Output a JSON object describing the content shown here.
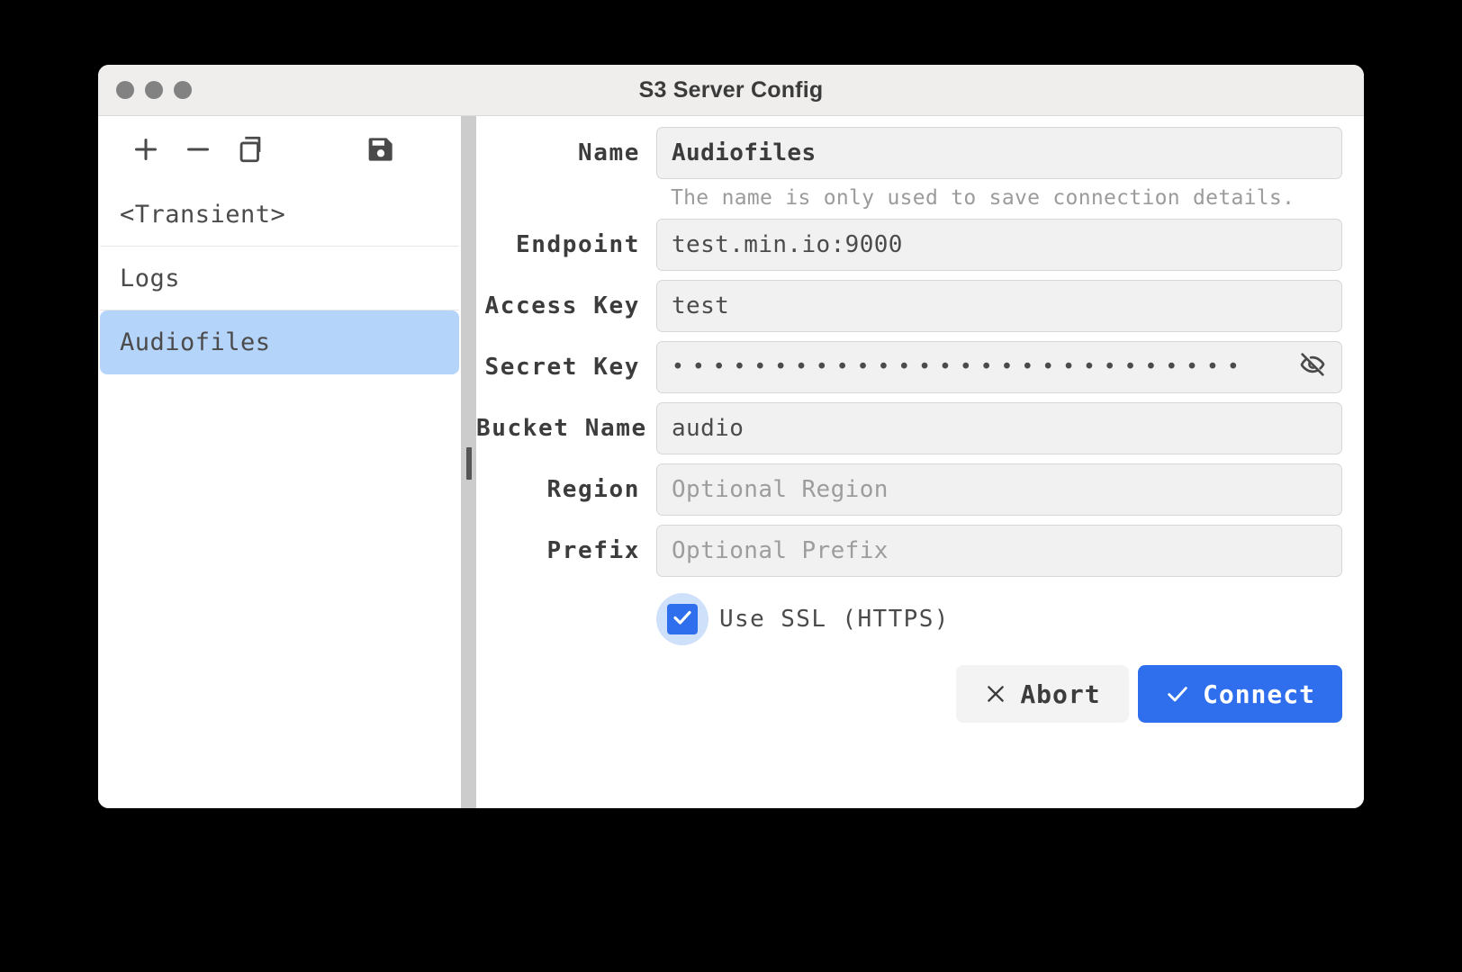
{
  "window": {
    "title": "S3 Server Config",
    "traffic_lights": [
      "close",
      "minimize",
      "maximize"
    ]
  },
  "sidebar": {
    "toolbar": [
      {
        "name": "add",
        "icon": "plus-icon"
      },
      {
        "name": "remove",
        "icon": "minus-icon"
      },
      {
        "name": "duplicate",
        "icon": "copy-icon"
      },
      {
        "name": "save",
        "icon": "floppy-save-icon"
      }
    ],
    "items": [
      {
        "label": "<Transient>",
        "selected": false
      },
      {
        "label": "Logs",
        "selected": false
      },
      {
        "label": "Audiofiles",
        "selected": true
      }
    ]
  },
  "form": {
    "fields": [
      {
        "label": "Name",
        "value": "Audiofiles",
        "placeholder": ""
      },
      {
        "label": "Endpoint",
        "value": "test.min.io:9000",
        "placeholder": ""
      },
      {
        "label": "Access Key",
        "value": "test",
        "placeholder": ""
      },
      {
        "label": "Secret Key",
        "value": "••••••••••••••••••••••••••••",
        "placeholder": ""
      },
      {
        "label": "Bucket Name",
        "value": "audio",
        "placeholder": ""
      },
      {
        "label": "Region",
        "value": "",
        "placeholder": "Optional Region"
      },
      {
        "label": "Prefix",
        "value": "",
        "placeholder": "Optional Prefix"
      }
    ],
    "name_help": "The name is only used to save connection details.",
    "secret_mask": "••••••••••••••••••••••••••••",
    "reveal_icon": "eye-off-icon",
    "ssl": {
      "label": "Use SSL (HTTPS)",
      "checked": true
    }
  },
  "buttons": {
    "abort": {
      "label": "Abort",
      "icon": "close-x-icon"
    },
    "connect": {
      "label": "Connect",
      "icon": "check-icon"
    }
  },
  "colors": {
    "accent": "#2f6fed",
    "selection": "#b5d4fa",
    "checkbox_ring": "#cfe0fb",
    "field_bg": "#f1f1f1",
    "titlebar_bg": "#efeeec",
    "splitter": "#cccccc"
  }
}
